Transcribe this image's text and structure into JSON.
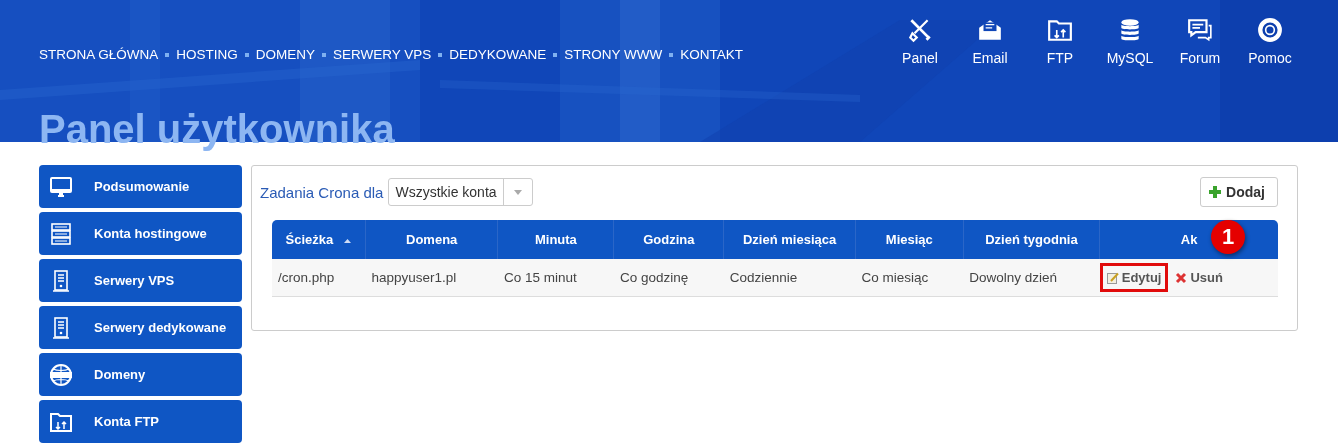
{
  "nav": [
    {
      "label": "STRONA GŁÓWNA"
    },
    {
      "label": "HOSTING"
    },
    {
      "label": "DOMENY"
    },
    {
      "label": "SERWERY VPS"
    },
    {
      "label": "DEDYKOWANE"
    },
    {
      "label": "STRONY WWW"
    },
    {
      "label": "KONTAKT"
    }
  ],
  "quick_links": [
    {
      "label": "Panel",
      "kind": "tools"
    },
    {
      "label": "Email",
      "kind": "mail"
    },
    {
      "label": "FTP",
      "kind": "folder"
    },
    {
      "label": "MySQL",
      "kind": "database"
    },
    {
      "label": "Forum",
      "kind": "chat"
    },
    {
      "label": "Pomoc",
      "kind": "lifebuoy"
    }
  ],
  "page_title": "Panel użytkownika",
  "sidebar": {
    "items": [
      {
        "label": "Podsumowanie",
        "kind": "monitor"
      },
      {
        "label": "Konta hostingowe",
        "kind": "servers"
      },
      {
        "label": "Serwery VPS",
        "kind": "tower"
      },
      {
        "label": "Serwery dedykowane",
        "kind": "tower"
      },
      {
        "label": "Domeny",
        "kind": "globe"
      },
      {
        "label": "Konta FTP",
        "kind": "folder"
      }
    ]
  },
  "cron_panel": {
    "title": "Zadania Crona dla",
    "account_select": {
      "value": "Wszystkie konta"
    },
    "add_button": "Dodaj",
    "table": {
      "columns": [
        {
          "label": "Ścieżka",
          "sorted": true
        },
        {
          "label": "Domena",
          "sorted": false
        },
        {
          "label": "Minuta",
          "sorted": false
        },
        {
          "label": "Godzina",
          "sorted": false
        },
        {
          "label": "Dzień miesiąca",
          "sorted": false
        },
        {
          "label": "Miesiąc",
          "sorted": false
        },
        {
          "label": "Dzień tygodnia",
          "sorted": false
        },
        {
          "label": "Ak",
          "sorted": false
        }
      ],
      "rows": [
        {
          "cells": [
            "/cron.php",
            "happyuser1.pl",
            "Co 15 minut",
            "Co godzinę",
            "Codziennie",
            "Co miesiąc",
            "Dowolny dzień"
          ],
          "actions": [
            {
              "kind": "edit",
              "label": "Edytuj",
              "highlighted": true
            },
            {
              "kind": "delete",
              "label": "Usuń",
              "highlighted": false
            }
          ]
        }
      ]
    },
    "step_badge": "1"
  }
}
